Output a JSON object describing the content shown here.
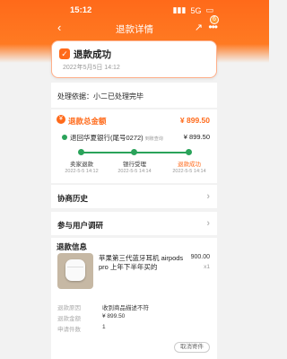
{
  "status_bar": {
    "time": "15:12",
    "signal": "5G",
    "battery": "▭"
  },
  "nav": {
    "title": "退款详情",
    "badge": "6"
  },
  "hero": {
    "status": "退款成功",
    "datetime": "2022年5月5日 14:12"
  },
  "basis": {
    "text": "处理依据：小二已处理完毕"
  },
  "refund": {
    "label": "退款总金额",
    "amount": "¥ 899.50",
    "bank_text": "退回华夏银行(尾号0272)",
    "bank_tag": "到账查询",
    "bank_amount": "¥ 899.50",
    "steps": [
      {
        "label": "卖家退款",
        "date": "2022-5-5 14:12"
      },
      {
        "label": "银行受理",
        "date": "2022-5-5 14:14"
      },
      {
        "label": "退款成功",
        "date": "2022-5-5 14:14"
      }
    ]
  },
  "sections": {
    "history": "协商历史",
    "survey": "参与用户调研"
  },
  "info": {
    "title": "退款信息",
    "product_name": "苹果第三代蓝牙耳机 airpods pro 上年下半年买的",
    "product_price": "900.00",
    "product_qty": "x1",
    "rows": [
      {
        "key": "退款原因",
        "value": "收到商品描述不符"
      },
      {
        "key": "退款金额",
        "value": "¥ 899.50"
      },
      {
        "key": "申请件数",
        "value": "1"
      }
    ],
    "cancel_button": "取消寄件"
  }
}
